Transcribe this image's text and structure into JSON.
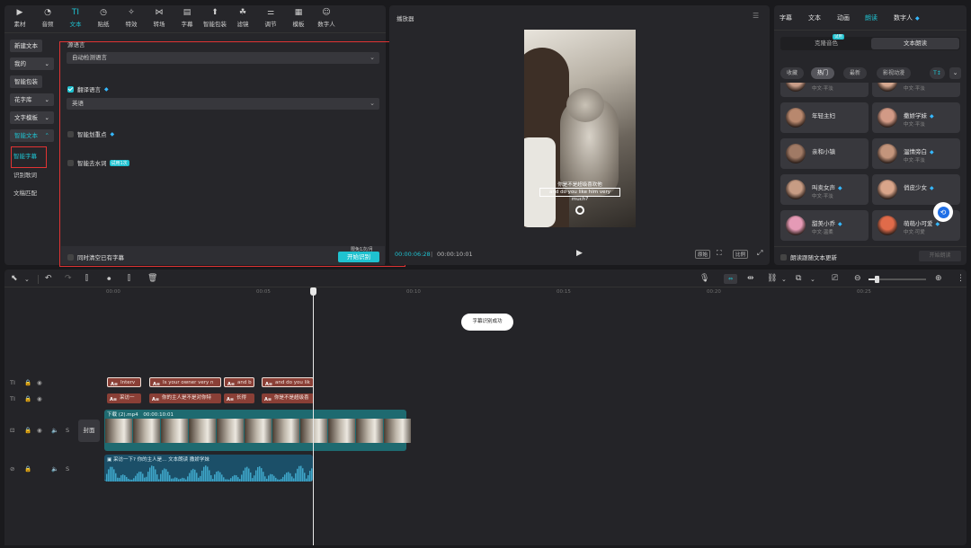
{
  "toolbar": {
    "items": [
      {
        "label": "素材",
        "icon": "media-icon"
      },
      {
        "label": "音频",
        "icon": "audio-icon"
      },
      {
        "label": "文本",
        "icon": "text-icon",
        "active": true
      },
      {
        "label": "贴纸",
        "icon": "sticker-icon"
      },
      {
        "label": "特效",
        "icon": "effects-icon"
      },
      {
        "label": "转场",
        "icon": "transition-icon"
      },
      {
        "label": "字幕",
        "icon": "subtitle-icon"
      },
      {
        "label": "智能包装",
        "icon": "smart-pack-icon"
      },
      {
        "label": "滤镜",
        "icon": "filter-icon"
      },
      {
        "label": "调节",
        "icon": "adjust-icon"
      },
      {
        "label": "模板",
        "icon": "template-icon"
      },
      {
        "label": "数字人",
        "icon": "digital-human-icon"
      }
    ],
    "accent": "#1fc2d0"
  },
  "sidebar": {
    "new_text": "新建文本",
    "mine": "我的",
    "smart_pack": "智能包装",
    "font_lib": "花字库",
    "text_template": "文字模板",
    "smart_text": "智能文本",
    "smart_subtitle": "智能字幕",
    "recognize_lyrics": "识别歌词",
    "doc_match": "文稿匹配"
  },
  "settings": {
    "source_lang_label": "源语言",
    "source_lang_value": "自动检测语言",
    "translate_label": "翻译语言",
    "translate_value": "英语",
    "highlight_label": "智能划重点",
    "remove_filler_label": "智能去水词",
    "trial_badge": "试用1次",
    "clear_existing_label": "同时清空已有字幕",
    "start_button": "开始识别",
    "quota_badge": "限免1次/月"
  },
  "player": {
    "title": "播放器",
    "subtitle_cn": "你是不是超级喜欢他",
    "subtitle_en": "and do you like him very much?",
    "current_time": "00:00:06:28",
    "total_time": "00:00:10:01",
    "btn_original": "原始",
    "btn_ratio": "比例"
  },
  "right_panel": {
    "tabs": [
      "字幕",
      "文本",
      "动画",
      "朗读",
      "数字人"
    ],
    "active_tab": "朗读",
    "mode_clone": "克隆音色",
    "mode_clone_badge": "试用",
    "mode_read": "文本朗读",
    "chips": [
      "收藏",
      "热门",
      "最新",
      "影视动漫"
    ],
    "active_chip": "热门",
    "voices": [
      {
        "name": "",
        "sub": "中文·平淡",
        "color": "#c89d88"
      },
      {
        "name": "",
        "sub": "中文·平淡",
        "color": "#d5a890"
      },
      {
        "name": "年轻主妇",
        "sub": "",
        "color": "#b8886e"
      },
      {
        "name": "撒娇学妹",
        "sub": "中文·平淡",
        "color": "#d29a86",
        "vip": true
      },
      {
        "name": "亲和小镇",
        "sub": "",
        "color": "#a07a65"
      },
      {
        "name": "温情旁白",
        "sub": "中文·平淡",
        "color": "#c3957c",
        "vip": true
      },
      {
        "name": "叫卖女声",
        "sub": "中文·平淡",
        "color": "#c79c84",
        "vip": true
      },
      {
        "name": "俏皮少女",
        "sub": "",
        "color": "#d9a58a",
        "vip": true
      },
      {
        "name": "甜美小乔",
        "sub": "中文·温柔",
        "color": "#e59ab6",
        "vip": true
      },
      {
        "name": "萌萌小可爱",
        "sub": "中文·可爱",
        "color": "#e06b4a",
        "vip": true
      }
    ],
    "follow_label": "朗读跟随文本更新",
    "start_read": "开始朗读"
  },
  "timeline": {
    "ticks": [
      "00:00",
      "00:05",
      "00:10",
      "00:15",
      "00:20",
      "00:25"
    ],
    "toast": "字幕识别成功",
    "cover_label": "封面",
    "video_clip_name": "下载 (2).mp4",
    "video_clip_duration": "00:00:10:01",
    "audio_clip_label": "采访一下? 你的主人是...  文本朗读 撒娇学妹",
    "en_clips": [
      "Interv",
      "Is your owner very n",
      "and b",
      "and do you lik"
    ],
    "cn_clips": [
      "采访一",
      "你的主人是不是对你特",
      "长得",
      "你是不是超级喜"
    ]
  }
}
